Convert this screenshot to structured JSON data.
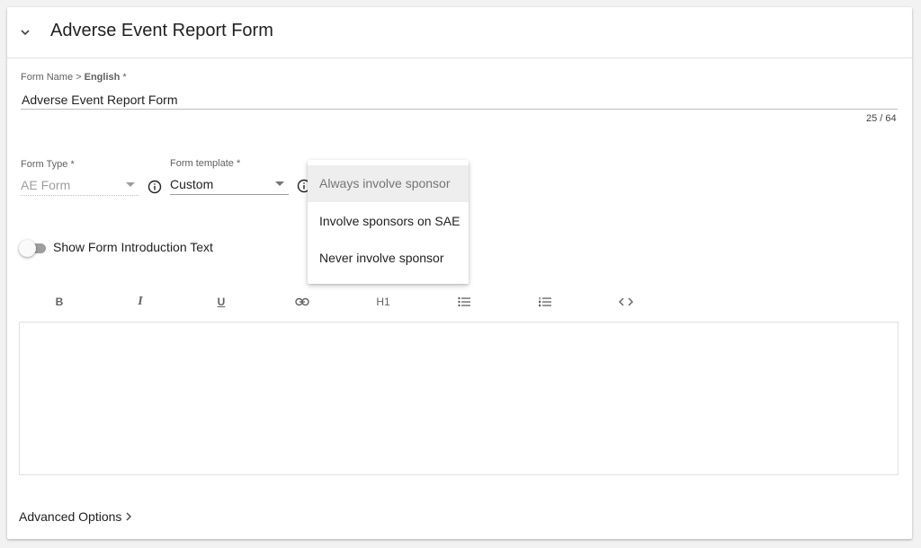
{
  "header": {
    "title": "Adverse Event Report Form",
    "collapse_icon": "chevron-down-icon"
  },
  "form_name": {
    "label": "Form Name > ",
    "language": "English",
    "required_mark": "*",
    "value": "Adverse Event Report Form",
    "counter": "25 / 64"
  },
  "form_type": {
    "label": "Form Type",
    "required_mark": "*",
    "value": "AE Form"
  },
  "form_template": {
    "label": "Form template",
    "required_mark": "*",
    "value": "Custom"
  },
  "sponsor_dropdown": {
    "options": [
      "Always involve sponsor",
      "Involve sponsors on SAE",
      "Never involve sponsor"
    ],
    "highlighted": "Always involve sponsor"
  },
  "intro_toggle": {
    "label": "Show Form Introduction Text",
    "state": "off"
  },
  "editor_toolbar": {
    "bold": "B",
    "italic": "I",
    "underline": "U",
    "heading": "H1"
  },
  "advanced_options": {
    "label": "Advanced Options"
  },
  "colors": {
    "card_background": "#ffffff",
    "page_background": "#f2f2f2",
    "highlight_row": "#eeeeee",
    "toggle_track": "#9e9e9e"
  }
}
